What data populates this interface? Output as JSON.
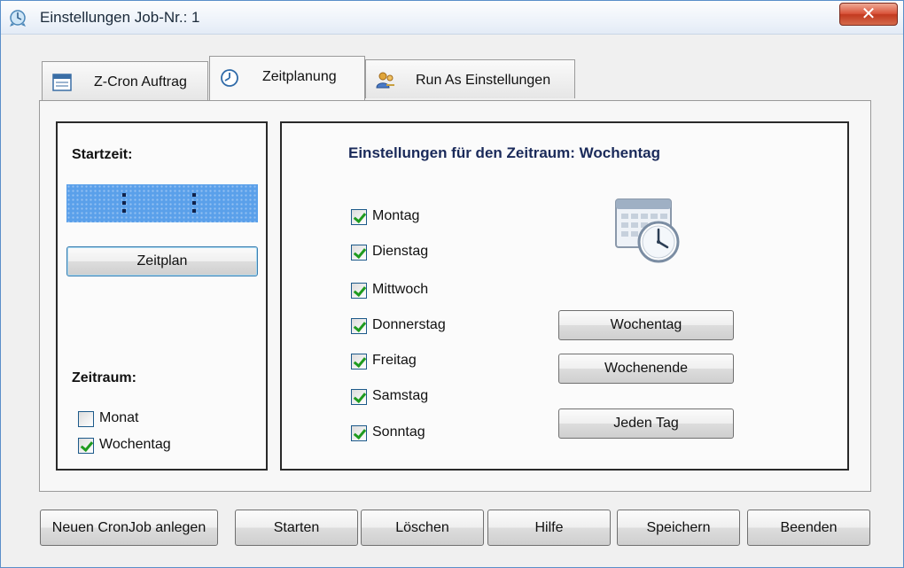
{
  "window": {
    "title": "Einstellungen Job-Nr.: 1",
    "close_label": "✕"
  },
  "tabs": [
    {
      "label": "Z-Cron Auftrag",
      "icon": "window-icon"
    },
    {
      "label": "Zeitplanung",
      "icon": "clock-icon",
      "active": true
    },
    {
      "label": "Run As Einstellungen",
      "icon": "users-icon"
    }
  ],
  "left": {
    "startzeit_label": "Startzeit:",
    "zeitplan_button": "Zeitplan",
    "zeitraum_label": "Zeitraum:",
    "options": [
      {
        "label": "Monat",
        "checked": false
      },
      {
        "label": "Wochentag",
        "checked": true
      }
    ]
  },
  "right": {
    "heading": "Einstellungen für den Zeitraum: Wochentag",
    "days": [
      {
        "label": "Montag",
        "checked": true
      },
      {
        "label": "Dienstag",
        "checked": true
      },
      {
        "label": "Mittwoch",
        "checked": true
      },
      {
        "label": "Donnerstag",
        "checked": true
      },
      {
        "label": "Freitag",
        "checked": true
      },
      {
        "label": "Samstag",
        "checked": true
      },
      {
        "label": "Sonntag",
        "checked": true
      }
    ],
    "buttons": {
      "wochentag": "Wochentag",
      "wochenende": "Wochenende",
      "jeden_tag": "Jeden Tag"
    }
  },
  "footer": {
    "new_cronjob": "Neuen CronJob anlegen",
    "start": "Starten",
    "delete": "Löschen",
    "help": "Hilfe",
    "save": "Speichern",
    "quit": "Beenden"
  },
  "colors": {
    "accent": "#5aa0ea",
    "check": "#1f9b1f",
    "heading": "#1a2a5a",
    "close": "#c2391f"
  }
}
